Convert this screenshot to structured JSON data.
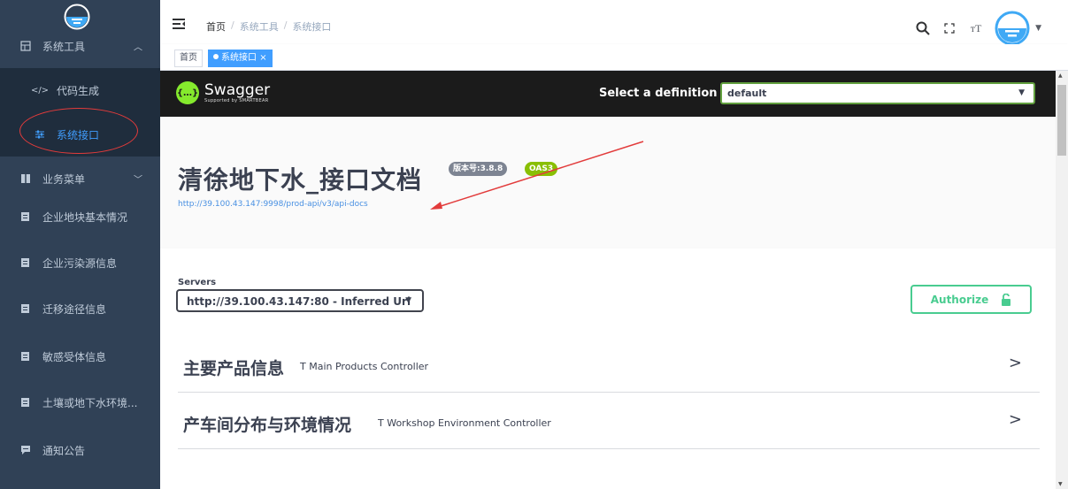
{
  "sidebar": {
    "group": {
      "label": "系统工具",
      "icon": "grid-icon"
    },
    "sub_items": [
      {
        "label": "代码生成",
        "icon": "code-icon"
      },
      {
        "label": "系统接口",
        "icon": "sliders-icon"
      }
    ],
    "items": [
      {
        "label": "业务菜单",
        "icon": "book-icon"
      },
      {
        "label": "企业地块基本情况",
        "icon": "doc-icon"
      },
      {
        "label": "企业污染源信息",
        "icon": "doc-icon"
      },
      {
        "label": "迁移途径信息",
        "icon": "doc-icon"
      },
      {
        "label": "敏感受体信息",
        "icon": "doc-icon"
      },
      {
        "label": "土壤或地下水环境...",
        "icon": "doc-icon"
      },
      {
        "label": "通知公告",
        "icon": "message-icon"
      }
    ]
  },
  "navbar": {
    "breadcrumb": {
      "home": "首页",
      "sep": "/",
      "level1": "系统工具",
      "current": "系统接口"
    }
  },
  "tags": {
    "home": "首页",
    "active": "系统接口",
    "close": "×"
  },
  "swagger": {
    "brand": "Swagger",
    "brand_sub": "Supported by SMARTBEAR",
    "definition_label": "Select a definition",
    "definition_value": "default",
    "title": "清徐地下水_接口文档",
    "version_badge": "版本号:3.8.8",
    "oas_badge": "OAS3",
    "url": "http://39.100.43.147:9998/prod-api/v3/api-docs",
    "servers_label": "Servers",
    "server_value": "http://39.100.43.147:80 - Inferred Url",
    "authorize_label": "Authorize",
    "operations": [
      {
        "name": "主要产品信息",
        "desc": "T Main Products Controller"
      },
      {
        "name": "产车间分布与环境情况",
        "desc": "T Workshop Environment Controller"
      }
    ]
  },
  "colors": {
    "sidebar_bg": "#304156",
    "active_blue": "#409eff",
    "swagger_green": "#85ea2d",
    "authorize_green": "#49cc90",
    "annotation_red": "#e23b3b"
  }
}
